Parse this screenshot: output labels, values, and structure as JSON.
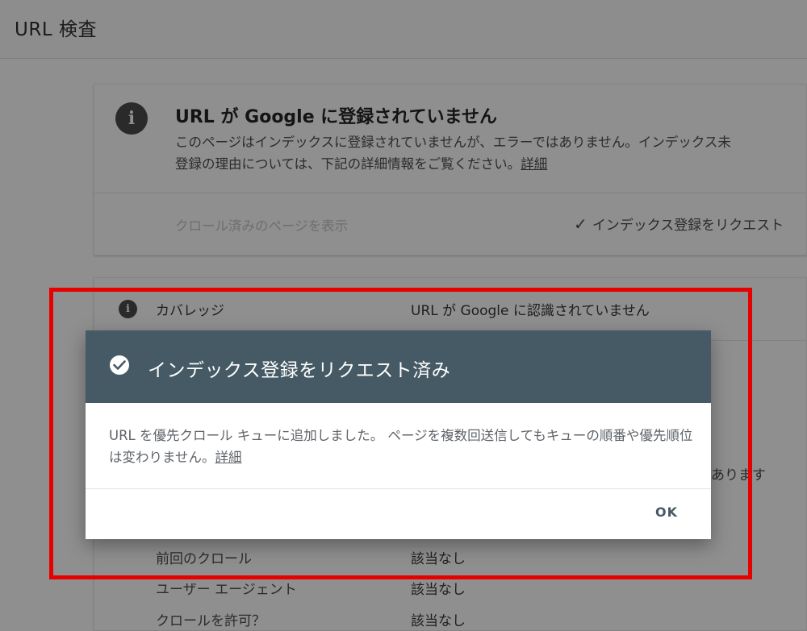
{
  "header": {
    "title": "URL 検査"
  },
  "status_card": {
    "icon": "info-icon",
    "headline": "URL が Google に登録されていません",
    "description": "このページはインデックスに登録されていませんが、エラーではありません。インデックス未登録の理由については、下記の詳細情報をご覧ください。",
    "details_link": "詳細",
    "view_crawled_label": "クロール済みのページを表示",
    "request_indexing_label": "インデックス登録をリクエスト"
  },
  "coverage": {
    "icon": "info-icon",
    "label": "カバレッジ",
    "value": "URL が Google に認識されていません",
    "partial_text": "あります",
    "rows": [
      {
        "label": "前回のクロール",
        "value": "該当なし"
      },
      {
        "label": "ユーザー エージェント",
        "value": "該当なし"
      },
      {
        "label": "クロールを許可？",
        "value": "該当なし"
      }
    ]
  },
  "dialog": {
    "icon": "check-circle-icon",
    "title": "インデックス登録をリクエスト済み",
    "message": "URL を優先クロール キューに追加しました。 ページを複数回送信してもキューの順番や優先順位は変わりません。",
    "details_link": "詳細",
    "ok_label": "OK"
  },
  "colors": {
    "dialog_header": "#455a64",
    "highlight_border": "#e60000",
    "overlay_bg": "#8f8f8f"
  }
}
